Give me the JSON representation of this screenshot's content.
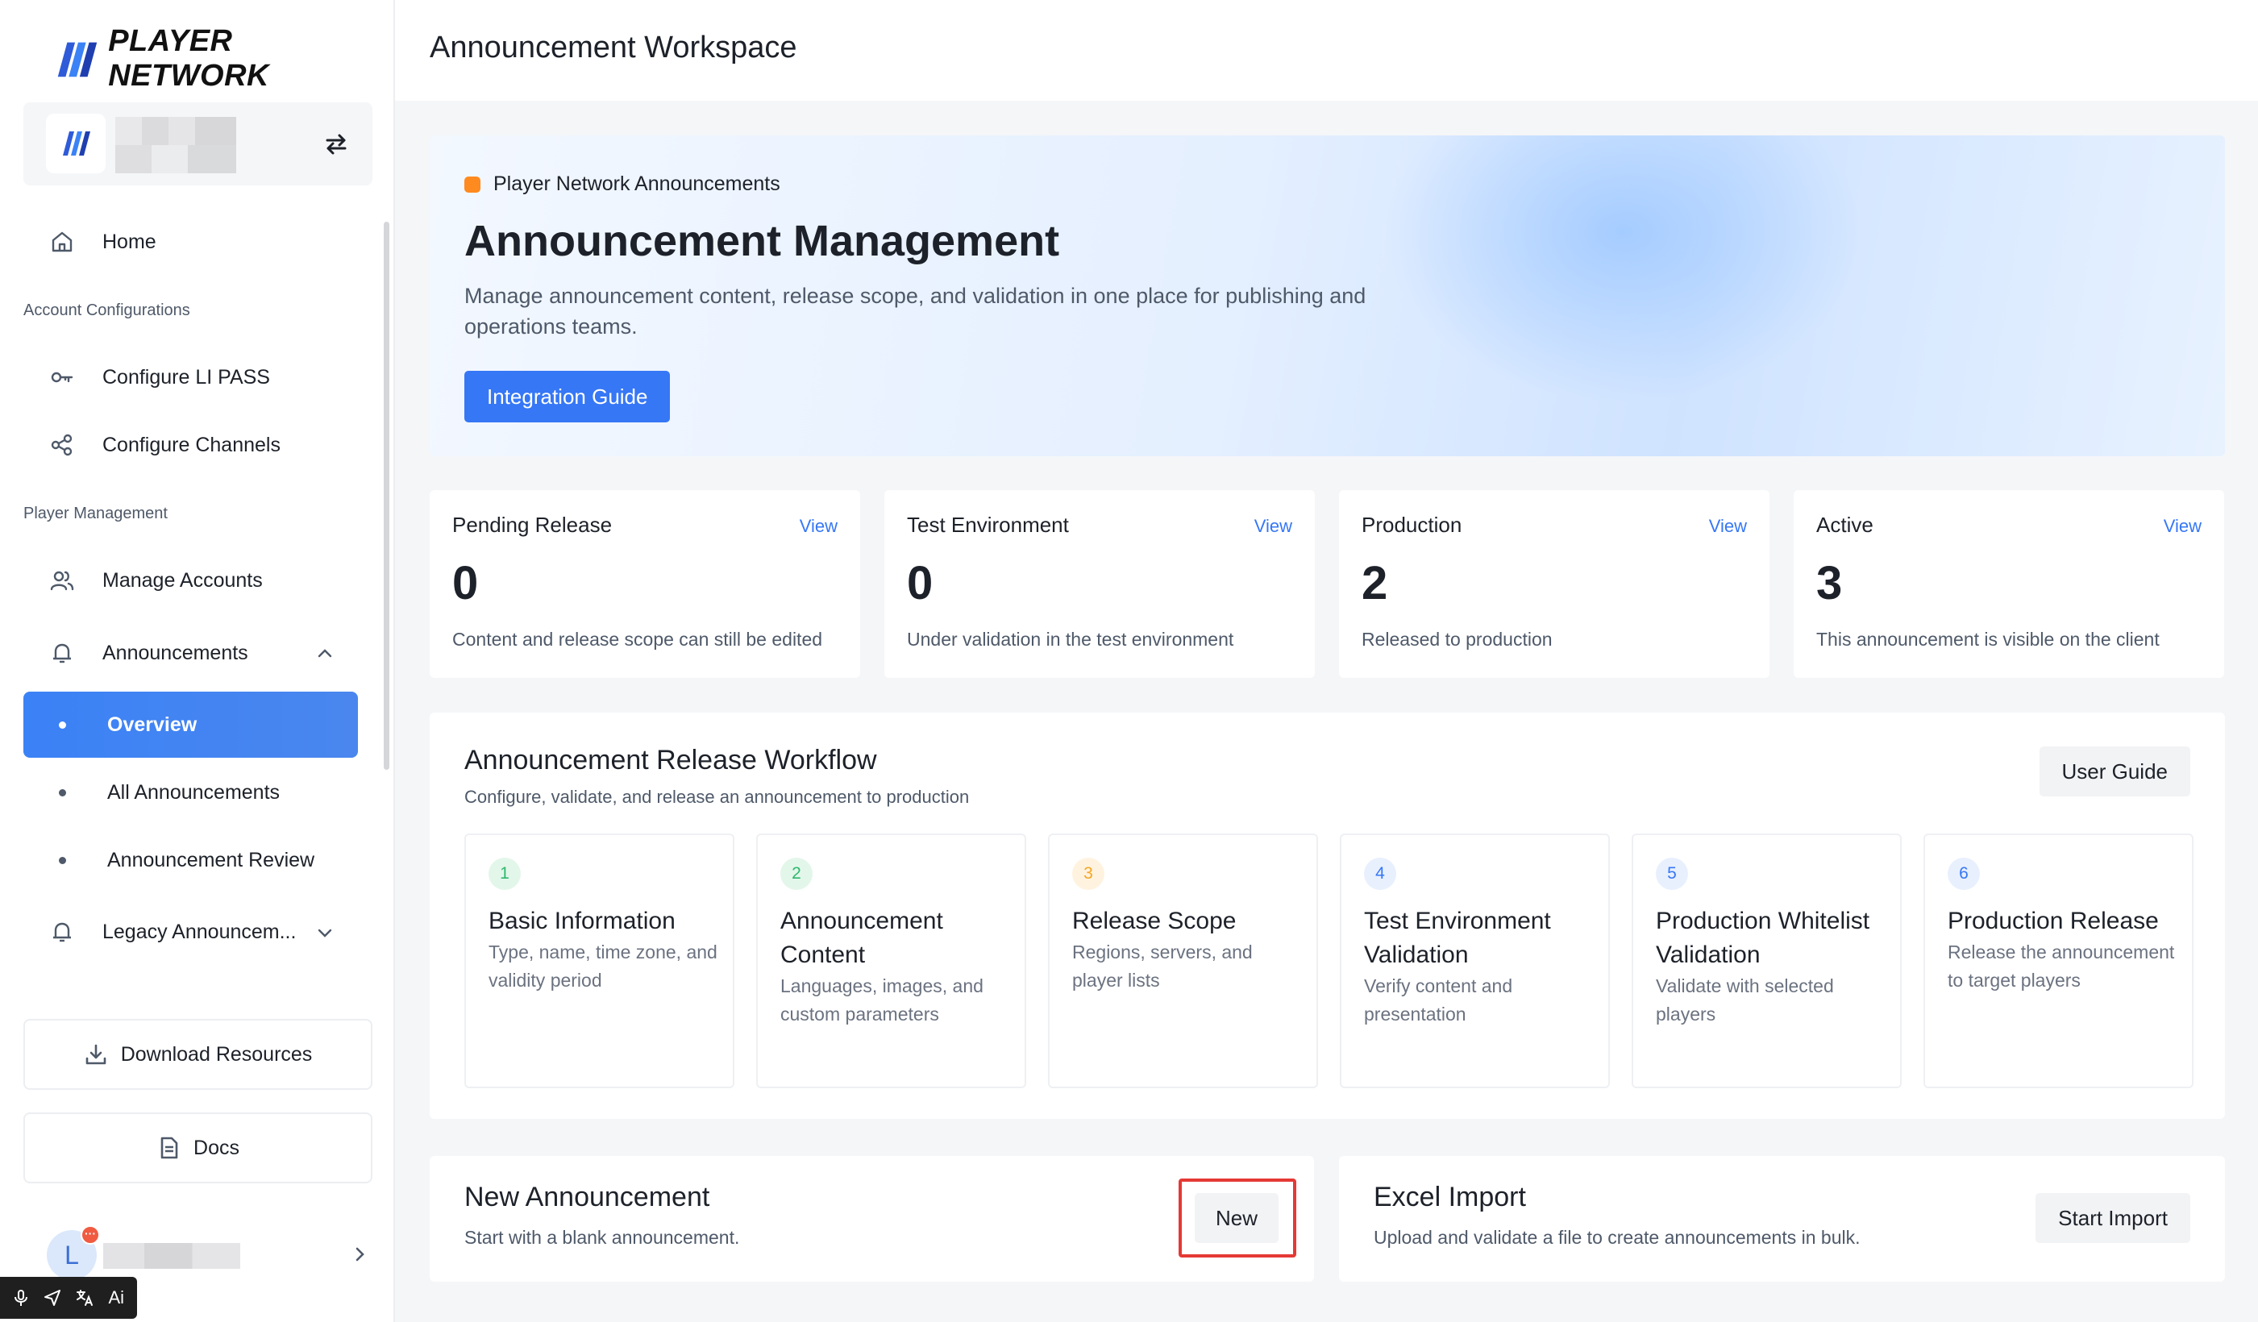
{
  "brand": {
    "name": "PLAYER NETWORK"
  },
  "sidebar": {
    "home": "Home",
    "section_account": "Account Configurations",
    "configure_li_pass": "Configure LI PASS",
    "configure_channels": "Configure Channels",
    "section_player": "Player Management",
    "manage_accounts": "Manage Accounts",
    "announcements": "Announcements",
    "overview": "Overview",
    "all_announcements": "All Announcements",
    "announcement_review": "Announcement Review",
    "legacy_announcements": "Legacy Announcem...",
    "download_resources": "Download Resources",
    "docs": "Docs",
    "user_initial": "L",
    "user_badge": "···",
    "toolbar_ai": "Ai"
  },
  "header": {
    "title": "Announcement Workspace"
  },
  "hero": {
    "tag": "Player Network Announcements",
    "title": "Announcement Management",
    "description": "Manage announcement content, release scope, and validation in one place for publishing and operations teams.",
    "button": "Integration Guide"
  },
  "stats": [
    {
      "title": "Pending Release",
      "view": "View",
      "value": "0",
      "desc": "Content and release scope can still be edited"
    },
    {
      "title": "Test Environment",
      "view": "View",
      "value": "0",
      "desc": "Under validation in the test environment"
    },
    {
      "title": "Production",
      "view": "View",
      "value": "2",
      "desc": "Released to production"
    },
    {
      "title": "Active",
      "view": "View",
      "value": "3",
      "desc": "This announcement is visible on the client"
    }
  ],
  "workflow": {
    "title": "Announcement Release Workflow",
    "subtitle": "Configure, validate, and release an announcement to production",
    "guide_button": "User Guide",
    "steps": [
      {
        "num": "1",
        "title": "Basic Information",
        "desc": "Type, name, time zone, and validity period",
        "color": "#2fb86e",
        "bg": "#e3f6ea"
      },
      {
        "num": "2",
        "title": "Announcement Content",
        "desc": "Languages, images, and custom parameters",
        "color": "#2fb86e",
        "bg": "#e3f6ea"
      },
      {
        "num": "3",
        "title": "Release Scope",
        "desc": "Regions, servers, and player lists",
        "color": "#f5a623",
        "bg": "#fff3e0"
      },
      {
        "num": "4",
        "title": "Test Environment Validation",
        "desc": "Verify content and presentation",
        "color": "#3677f5",
        "bg": "#e8f0fe"
      },
      {
        "num": "5",
        "title": "Production Whitelist Validation",
        "desc": "Validate with selected players",
        "color": "#3677f5",
        "bg": "#e8f0fe"
      },
      {
        "num": "6",
        "title": "Production Release",
        "desc": "Release the announcement to target players",
        "color": "#3677f5",
        "bg": "#e8f0fe"
      }
    ]
  },
  "new_announcement": {
    "title": "New Announcement",
    "subtitle": "Start with a blank announcement.",
    "button": "New"
  },
  "excel_import": {
    "title": "Excel Import",
    "subtitle": "Upload and validate a file to create announcements in bulk.",
    "button": "Start Import"
  },
  "colors": {
    "primary": "#3677f5",
    "highlight": "#e53935",
    "tag": "#ff8a1f"
  }
}
